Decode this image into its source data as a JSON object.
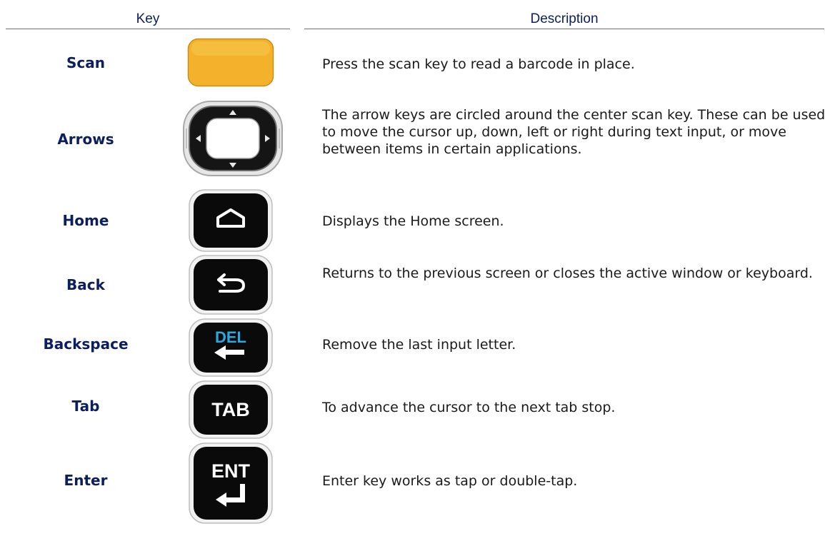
{
  "header": {
    "key": "Key",
    "description": "Description"
  },
  "rows": [
    {
      "key": "Scan",
      "icon": "scan-key-icon",
      "description": "Press the scan key to read a barcode in place."
    },
    {
      "key": "Arrows",
      "icon": "arrow-keys-icon",
      "description": "The arrow keys are circled around the center scan key. These can be used to move the cursor up, down, left or right during text input, or move between items in certain applications."
    },
    {
      "key": "Home",
      "icon": "home-key-icon",
      "description": "Displays the Home screen."
    },
    {
      "key": "Back",
      "icon": "back-key-icon",
      "description": "Returns to the previous screen or closes the active window or keyboard."
    },
    {
      "key": "Backspace",
      "icon": "backspace-key-icon",
      "label": "DEL",
      "description": "Remove the last input letter."
    },
    {
      "key": "Tab",
      "icon": "tab-key-icon",
      "label": "TAB",
      "description": "To advance the cursor to the next tab stop."
    },
    {
      "key": "Enter",
      "icon": "enter-key-icon",
      "label": "ENT",
      "description": "Enter key works as tap or double-tap."
    }
  ],
  "colors": {
    "heading": "#0d1e5c",
    "scan_key": "#f4b22c",
    "key_body": "#0a0a0a",
    "del_label": "#29a9e1"
  }
}
